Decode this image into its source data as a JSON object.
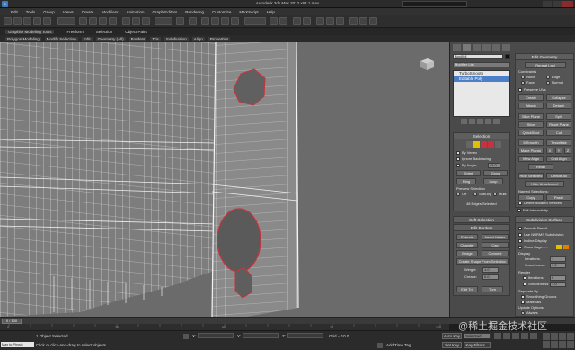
{
  "app": {
    "title": "Autodesk 3ds Max 2012 x64    1.max",
    "search_placeholder": "Type a keyword or phrase"
  },
  "menu": [
    "Edit",
    "Tools",
    "Group",
    "Views",
    "Create",
    "Modifiers",
    "Animation",
    "Graph Editors",
    "Rendering",
    "Customize",
    "MAXScript",
    "Help"
  ],
  "ribbon": {
    "tabs": [
      "Graphite Modeling Tools",
      "Freeform",
      "Selection",
      "Object Paint"
    ],
    "subtabs": [
      "Polygon Modeling",
      "Modify Selection",
      "Edit",
      "Geometry (All)",
      "Borders",
      "Tris",
      "Subdivision",
      "Align",
      "Properties"
    ]
  },
  "viewport": {
    "label": "[ + ] [Perspective] [ Realistic + Edged Faces ]"
  },
  "modifier_panel": {
    "object_name": "Box004",
    "modifier_list": "Modifier List",
    "stack": [
      "TurboSmooth",
      "Editable Poly"
    ]
  },
  "selection": {
    "title": "Selection",
    "by_vertex": "By Vertex",
    "ignore_backfacing": "Ignore Backfacing",
    "by_angle": "By Angle:",
    "angle_value": "45.0",
    "shrink": "Shrink",
    "grow": "Grow",
    "ring": "Ring",
    "loop": "Loop",
    "preview_selection": "Preview Selection",
    "preview_off": "Off",
    "preview_subobj": "SubObj",
    "preview_multi": "Multi",
    "status": "48 Edges Selected"
  },
  "soft_selection": {
    "title": "Soft Selection"
  },
  "edit_borders": {
    "title": "Edit Borders",
    "extrude": "Extrude",
    "insert_vertex": "Insert Vertex",
    "chamfer": "Chamfer",
    "cap": "Cap",
    "bridge": "Bridge",
    "connect": "Connect",
    "create_shape": "Create Shape From Selection",
    "weight_label": "Weight:",
    "weight_value": "1.0",
    "crease_label": "Crease:",
    "crease_value": "0.0",
    "edit_tri": "Edit Tri.",
    "turn": "Turn"
  },
  "edit_geometry": {
    "title": "Edit Geometry",
    "repeat_last": "Repeat Last",
    "constraints": "Constraints",
    "none": "None",
    "edge": "Edge",
    "face": "Face",
    "normal": "Normal",
    "preserve_uvs": "Preserve UVs",
    "create": "Create",
    "collapse": "Collapse",
    "attach": "Attach",
    "detach": "Detach",
    "slice_plane": "Slice Plane",
    "split": "Split",
    "slice": "Slice",
    "reset_plane": "Reset Plane",
    "quickslice": "QuickSlice",
    "cut": "Cut",
    "msmooth": "MSmooth",
    "tessellate": "Tessellate",
    "make_planar": "Make Planar",
    "x": "X",
    "y": "Y",
    "z": "Z",
    "view_align": "View Align",
    "grid_align": "Grid Align",
    "relax": "Relax",
    "hide_selected": "Hide Selected",
    "unhide_all": "Unhide All",
    "hide_unselected": "Hide Unselected",
    "named_selections": "Named Selections:",
    "copy": "Copy",
    "paste": "Paste",
    "delete_isolated": "Delete Isolated Vertices",
    "full_interactivity": "Full Interactivity"
  },
  "subdivision_surface": {
    "title": "Subdivision Surface",
    "smooth_result": "Smooth Result",
    "use_nurms": "Use NURMS Subdivision",
    "isoline_display": "Isoline Display",
    "show_cage": "Show Cage......",
    "display": "Display",
    "iterations_label": "Iterations:",
    "iterations_value": "1",
    "smoothness_label": "Smoothness:",
    "smoothness_value": "1.0",
    "render": "Render",
    "r_iterations_value": "0",
    "r_smoothness_value": "1.0",
    "separate_by": "Separate By",
    "smoothing_groups": "Smoothing Groups",
    "materials": "Materials",
    "update_options": "Update Options",
    "always": "Always",
    "when_rendering": "When Rendering",
    "manually": "Manually"
  },
  "timeline": {
    "frame": "0 / 100"
  },
  "ruler_ticks": [
    "0",
    "5",
    "10",
    "15",
    "20",
    "25",
    "30",
    "35",
    "40",
    "45",
    "50",
    "55",
    "60",
    "65",
    "70",
    "75",
    "80",
    "85",
    "90",
    "95",
    "100"
  ],
  "status": {
    "maxscript": "Max to Physic",
    "selected": "1 Object Selected",
    "prompt": "Click or click-and-drag to select objects",
    "x_label": "X:",
    "y_label": "Y:",
    "z_label": "Z:",
    "grid": "Grid = 10.0",
    "add_time_tag": "Add Time Tag",
    "auto_key": "Auto Key",
    "selected_dropdown": "Selected",
    "set_key": "Set Key",
    "key_filters": "Key Filters..."
  },
  "watermark": "@稀土掘金技术社区",
  "colors": {
    "selected_edges": "#c8323c",
    "accent_yellow": "#e0c000",
    "stack_selected": "#4b7fc7",
    "viewport_bg": "#6b6b6b"
  }
}
